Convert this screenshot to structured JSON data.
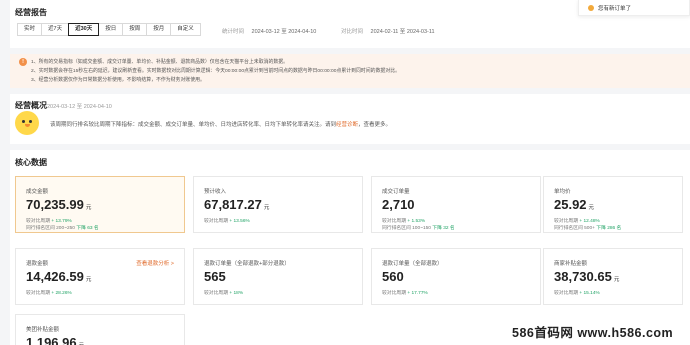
{
  "toast": {
    "text": "您有新订单了"
  },
  "report": {
    "title": "经营报告",
    "range_tabs": [
      "实时",
      "近7天",
      "近30天",
      "按日",
      "按周",
      "按月",
      "自定义"
    ],
    "active_tab": 2,
    "stat_label": "统计时间",
    "stat_range": "2024-03-12 至 2024-04-10",
    "compare_label": "对比时间",
    "compare_range": "2024-02-11 至 2024-03-11"
  },
  "notice": {
    "lines": [
      "1、所有的交易指标（如成交金额、成交订单量、单均价、补贴金额、退款商品数）仅包含在天猫平台上未取消的数据。",
      "2、实时数据会存在15秒左右的延迟，建议刷新查看。实时数据较对比周期计算逻辑：今天00:00:00点累计到当前时间点的数据与昨日00:00:00点累计到同时间的数据对比。",
      "3、经营分析数据仅作为日常数据分析使用，不影响结算，不作为财务对账使用。"
    ]
  },
  "overview": {
    "title": "经营概况",
    "date": "2024-03-12 至 2024-04-10",
    "desc_prefix": "该周期同行排名较比周期下降指标：成交金额、成交订单量、单均价、日均进店转化率、日均下单转化率请关注。请到",
    "desc_link": "经营诊断",
    "desc_suffix": "，查看更多。"
  },
  "core": {
    "title": "核心数据",
    "cards": [
      {
        "title": "成交金额",
        "value": "70,235.99",
        "unit": "元",
        "link": "",
        "compare_label": "较对比周期",
        "compare": "+ 13.79%",
        "rank_label": "同行排名区间",
        "rank": "200~250",
        "rank_change": "下降 63 名"
      },
      {
        "title": "预计收入",
        "value": "67,817.27",
        "unit": "元",
        "link": "",
        "compare_label": "较对比周期",
        "compare": "+ 13.56%",
        "rank_label": "",
        "rank": "",
        "rank_change": ""
      },
      {
        "title": "成交订单量",
        "value": "2,710",
        "unit": "",
        "link": "",
        "compare_label": "较对比周期",
        "compare": "+ 1.53%",
        "rank_label": "同行排名区间",
        "rank": "100~150",
        "rank_change": "下降 32 名"
      },
      {
        "title": "单均价",
        "value": "25.92",
        "unit": "元",
        "link": "",
        "compare_label": "较对比周期",
        "compare": "+ 12.48%",
        "rank_label": "同行排名区间",
        "rank": "500+",
        "rank_change": "下降 286 名"
      },
      {
        "title": "退款金额",
        "value": "14,426.59",
        "unit": "元",
        "link": "查看退款分析 >",
        "compare_label": "较对比周期",
        "compare": "+ 28.26%",
        "rank_label": "",
        "rank": "",
        "rank_change": ""
      },
      {
        "title": "退款订单量（全部退款+部分退款）",
        "value": "565",
        "unit": "",
        "link": "",
        "compare_label": "较对比周期",
        "compare": "+ 18%",
        "rank_label": "",
        "rank": "",
        "rank_change": ""
      },
      {
        "title": "退款订单量（全部退款）",
        "value": "560",
        "unit": "",
        "link": "",
        "compare_label": "较对比周期",
        "compare": "+ 17.77%",
        "rank_label": "",
        "rank": "",
        "rank_change": ""
      },
      {
        "title": "商家补贴金额",
        "value": "38,730.65",
        "unit": "元",
        "link": "",
        "compare_label": "较对比周期",
        "compare": "+ 15.14%",
        "rank_label": "",
        "rank": "",
        "rank_change": ""
      },
      {
        "title": "美团补贴金额",
        "value": "1,196.96",
        "unit": "元",
        "link": "",
        "compare_label": "",
        "compare": "",
        "rank_label": "",
        "rank": "",
        "rank_change": ""
      }
    ]
  },
  "watermark": "586首码网 www.h586.com"
}
